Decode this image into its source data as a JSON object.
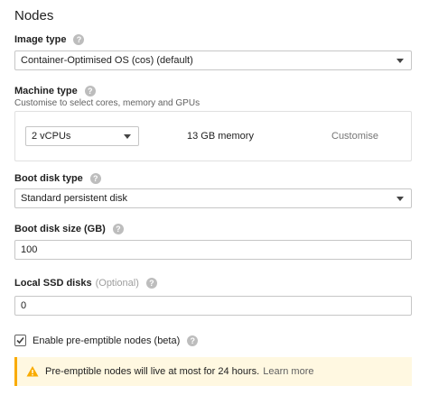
{
  "section": {
    "title": "Nodes"
  },
  "image_type": {
    "label": "Image type",
    "value": "Container-Optimised OS (cos) (default)"
  },
  "machine_type": {
    "label": "Machine type",
    "hint": "Customise to select cores, memory and GPUs",
    "cores_value": "2 vCPUs",
    "memory_text": "13 GB memory",
    "customise_label": "Customise"
  },
  "boot_disk_type": {
    "label": "Boot disk type",
    "value": "Standard persistent disk"
  },
  "boot_disk_size": {
    "label": "Boot disk size (GB)",
    "value": "100"
  },
  "local_ssd": {
    "label": "Local SSD disks",
    "optional_text": "(Optional)",
    "value": "0"
  },
  "preemptible": {
    "label": "Enable pre-emptible nodes (beta)",
    "checked": true
  },
  "banner": {
    "text": "Pre-emptible nodes will live at most for 24 hours.",
    "link": "Learn more"
  },
  "icons": {
    "help": "help-icon",
    "warning": "warning-icon",
    "dropdown": "chevron-down-icon"
  },
  "colors": {
    "warning_accent": "#f9ab00",
    "warning_bg": "#fff8e1",
    "border": "#c6c6c6"
  }
}
